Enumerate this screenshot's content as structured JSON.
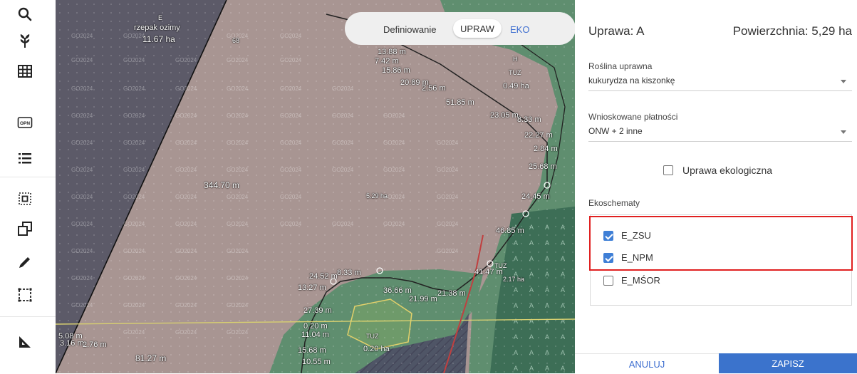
{
  "toolbar": {
    "items": [
      "search-icon",
      "plant-icon",
      "grid-icon",
      "opn-icon",
      "list-icon",
      "select-area-icon",
      "copy-shape-icon",
      "pencil-icon",
      "frame-icon",
      "ruler-icon"
    ],
    "opn_text": "OPN"
  },
  "map": {
    "watermark": "GO2024",
    "parcel_letter_e": "E",
    "parcel_crop_e": "rzepak ozimy",
    "parcel_area_e": "11.67 ha",
    "parcel_h_letter": "H",
    "parcel_h_crop": "TUZ",
    "parcel_h_area": "0.49 ha",
    "center_area": "5.29 ha",
    "tuz_label": "TUZ",
    "tuz_area": "2.17 ha",
    "tuz2_label": "TUZ",
    "tuz2_area": "0.20 ha",
    "label_68": "68",
    "measurements": {
      "m1": "13.88 m",
      "m2": "7.42 m",
      "m3": "15.86 m",
      "m4": "20.89 m",
      "m5": "2.56 m",
      "m6": "51.85 m",
      "m7": "23.05 m",
      "m8": "8.33 m",
      "m9": "22.27 m",
      "m10": "2.84 m",
      "m11": "25.68 m",
      "m12": "344.70 m",
      "m13": "24.45 m",
      "m14": "46.85 m",
      "m15": "41.47 m",
      "m16": "24.52 m",
      "m17": "8.33 m",
      "m18": "13.27 m",
      "m19": "36.66 m",
      "m20": "21.38 m",
      "m21": "21.99 m",
      "m22": "27.39 m",
      "m23": "0.20 m",
      "m24": "11.04 m",
      "m25": "15.68 m",
      "m26": "10.55 m",
      "m27": "5.08 m",
      "m28": "3.16 m",
      "m29": "2.76 m",
      "m30": "81.27 m"
    }
  },
  "mode_switch": {
    "label": "Definiowanie",
    "option_upraw": "UPRAW",
    "option_eko": "EKO",
    "active": "UPRAW"
  },
  "panel": {
    "title": "Uprawa: A",
    "area": "Powierzchnia: 5,29 ha",
    "crop_label": "Roślina uprawna",
    "crop_value": "kukurydza na kiszonkę",
    "payments_label": "Wnioskowane płatności",
    "payments_value": "ONW + 2 inne",
    "eco_checkbox_label": "Uprawa ekologiczna",
    "eco_checkbox_checked": false,
    "ekoschematy_label": "Ekoschematy",
    "ekoschematy": [
      {
        "label": "E_ZSU",
        "checked": true
      },
      {
        "label": "E_NPM",
        "checked": true
      },
      {
        "label": "E_MŚOR",
        "checked": false
      }
    ],
    "cancel_label": "ANULUJ",
    "save_label": "ZAPISZ"
  },
  "colors": {
    "accent": "#3b73cc",
    "link": "#3f6fd0",
    "highlight": "#e02020",
    "checkbox": "#3f7fd6"
  }
}
